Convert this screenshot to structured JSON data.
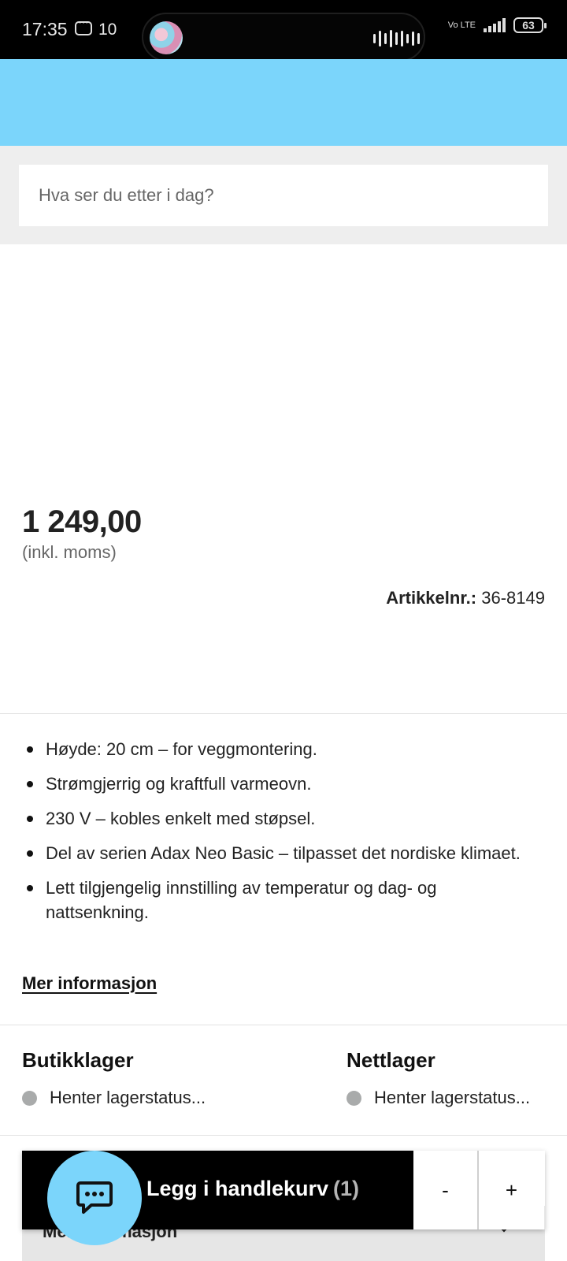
{
  "status_bar": {
    "time": "17:35",
    "notification_count": "10",
    "network": "Vo LTE",
    "battery": "63"
  },
  "search": {
    "placeholder": "Hva ser du etter i dag?"
  },
  "product": {
    "price": "1 249,00",
    "vat_note": "(inkl. moms)",
    "sku_label": "Artikkelnr.:",
    "sku_value": "36-8149"
  },
  "features": [
    "Høyde: 20 cm – for veggmontering.",
    "Strømgjerrig og kraftfull varmeovn.",
    "230 V – kobles enkelt med støpsel.",
    "Del av serien Adax Neo Basic – tilpasset det nordiske klimaet.",
    "Lett tilgjengelig innstilling av temperatur og dag- og nattsenkning."
  ],
  "more_info_link": "Mer informasjon",
  "stock": {
    "store": {
      "title": "Butikklager",
      "status": "Henter lagerstatus..."
    },
    "online": {
      "title": "Nettlager",
      "status": "Henter lagerstatus..."
    }
  },
  "cart": {
    "add_label": "Legg i handlekurv",
    "count": "(1)",
    "minus": "-",
    "plus": "+"
  },
  "info_panel": {
    "label": "Mer informasjon"
  },
  "colors": {
    "accent": "#7bd5fb",
    "stock_dot": "#a9abab"
  }
}
